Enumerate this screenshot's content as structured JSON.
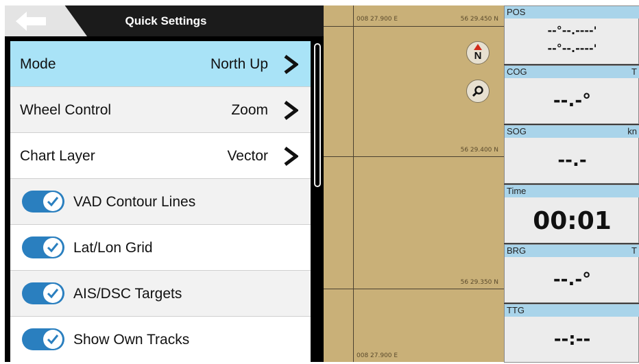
{
  "header": {
    "title": "Quick Settings"
  },
  "settings": [
    {
      "label": "Mode",
      "value": "North Up"
    },
    {
      "label": "Wheel Control",
      "value": "Zoom"
    },
    {
      "label": "Chart Layer",
      "value": "Vector"
    }
  ],
  "toggles": [
    {
      "label": "VAD Contour Lines",
      "checked": true
    },
    {
      "label": "Lat/Lon Grid",
      "checked": true
    },
    {
      "label": "AIS/DSC Targets",
      "checked": true
    },
    {
      "label": "Show Own Tracks",
      "checked": true
    }
  ],
  "map": {
    "lon_top": "008 27.900 E",
    "lat_top": "56 29.450 N",
    "lat_mid": "56 29.400 N",
    "lat_low": "56 29.350 N",
    "lon_bottom": "008 27.900 E",
    "north_label": "N"
  },
  "data_boxes": {
    "pos": {
      "title": "POS",
      "line1": "--°--.----'",
      "line2": "--°--.----'"
    },
    "cog": {
      "title": "COG",
      "unit": "T",
      "value": "--.-°"
    },
    "sog": {
      "title": "SOG",
      "unit": "kn",
      "value": "--.-"
    },
    "time": {
      "title": "Time",
      "value": "00:01"
    },
    "brg": {
      "title": "BRG",
      "unit": "T",
      "value": "--.-°"
    },
    "ttg": {
      "title": "TTG",
      "value": "--:--"
    }
  },
  "colors": {
    "selected_row": "#a9e3f7",
    "toggle_on": "#2a7fbf",
    "map_land": "#c9b078",
    "box_header": "#a9d4ea"
  }
}
